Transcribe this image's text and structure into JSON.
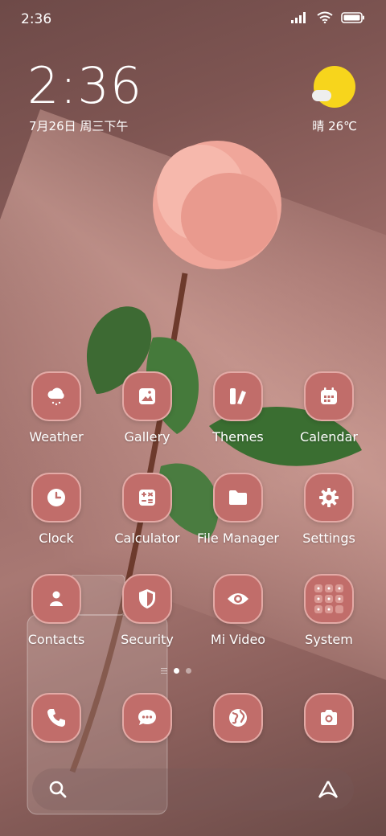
{
  "status": {
    "time": "2:36"
  },
  "widget": {
    "clock": "2:36",
    "date": "7月26日 周三下午",
    "weather": "晴 26℃",
    "weather_icon": "partly-sunny-icon"
  },
  "apps": [
    {
      "label": "Weather",
      "icon": "weather-icon"
    },
    {
      "label": "Gallery",
      "icon": "gallery-icon"
    },
    {
      "label": "Themes",
      "icon": "themes-icon"
    },
    {
      "label": "Calendar",
      "icon": "calendar-icon"
    },
    {
      "label": "Clock",
      "icon": "clock-icon"
    },
    {
      "label": "Calculator",
      "icon": "calculator-icon"
    },
    {
      "label": "File Manager",
      "icon": "folder-icon"
    },
    {
      "label": "Settings",
      "icon": "gear-icon"
    },
    {
      "label": "Contacts",
      "icon": "contacts-icon"
    },
    {
      "label": "Security",
      "icon": "shield-icon"
    },
    {
      "label": "Mi Video",
      "icon": "eye-icon"
    },
    {
      "label": "System",
      "icon": "folder-grid-icon"
    }
  ],
  "dock": [
    {
      "icon": "phone-icon"
    },
    {
      "icon": "messages-icon"
    },
    {
      "icon": "browser-icon"
    },
    {
      "icon": "camera-icon"
    }
  ],
  "colors": {
    "icon_bg": "#c16d6a",
    "sun": "#f7d51c"
  }
}
